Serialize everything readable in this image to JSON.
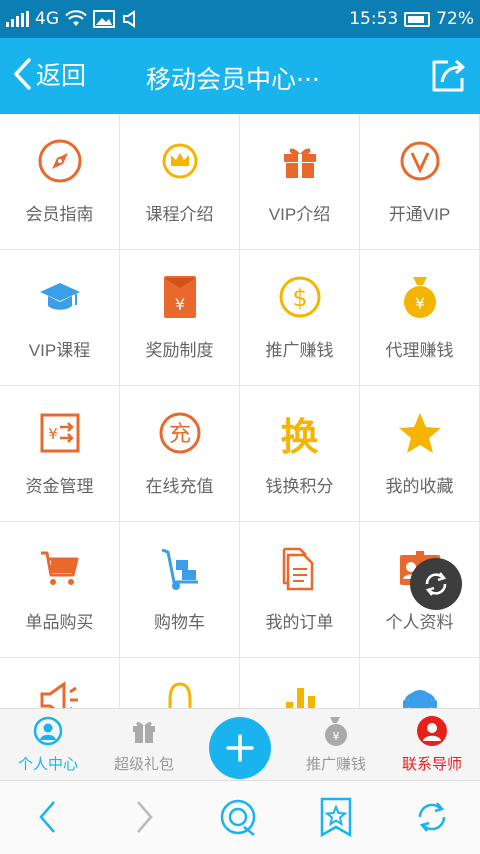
{
  "status_bar": {
    "network": "4G",
    "time": "15:53",
    "battery": "72%"
  },
  "header": {
    "back_label": "返回",
    "title": "移动会员中心···"
  },
  "grid": {
    "items": [
      {
        "label": "会员指南",
        "icon": "compass-icon"
      },
      {
        "label": "课程介绍",
        "icon": "crown-icon"
      },
      {
        "label": "VIP介绍",
        "icon": "gift-icon"
      },
      {
        "label": "开通VIP",
        "icon": "vip-icon"
      },
      {
        "label": "VIP课程",
        "icon": "graduation-cap-icon"
      },
      {
        "label": "奖励制度",
        "icon": "red-envelope-icon"
      },
      {
        "label": "推广赚钱",
        "icon": "dollar-icon"
      },
      {
        "label": "代理赚钱",
        "icon": "money-bag-icon"
      },
      {
        "label": "资金管理",
        "icon": "fund-transfer-icon"
      },
      {
        "label": "在线充值",
        "icon": "recharge-icon",
        "glyph": "充"
      },
      {
        "label": "钱换积分",
        "icon": "exchange-icon",
        "glyph": "换"
      },
      {
        "label": "我的收藏",
        "icon": "star-icon"
      },
      {
        "label": "单品购买",
        "icon": "cart-icon"
      },
      {
        "label": "购物车",
        "icon": "hand-truck-icon"
      },
      {
        "label": "我的订单",
        "icon": "order-document-icon"
      },
      {
        "label": "个人资料",
        "icon": "id-card-icon"
      }
    ]
  },
  "tabs": [
    {
      "label": "个人中心",
      "icon": "user-icon",
      "color": "#19b4ee"
    },
    {
      "label": "超级礼包",
      "icon": "gift-icon",
      "color": "#999999"
    },
    {
      "label": "推广赚钱",
      "icon": "money-bag-icon",
      "color": "#999999"
    },
    {
      "label": "联系导师",
      "icon": "mentor-avatar-icon",
      "color": "#e8201c"
    }
  ],
  "colors": {
    "brand": "#19b4ee",
    "status_bar": "#0b7fb3",
    "orange": "#e9692c",
    "yellow": "#f5b400",
    "red": "#e8201c"
  }
}
